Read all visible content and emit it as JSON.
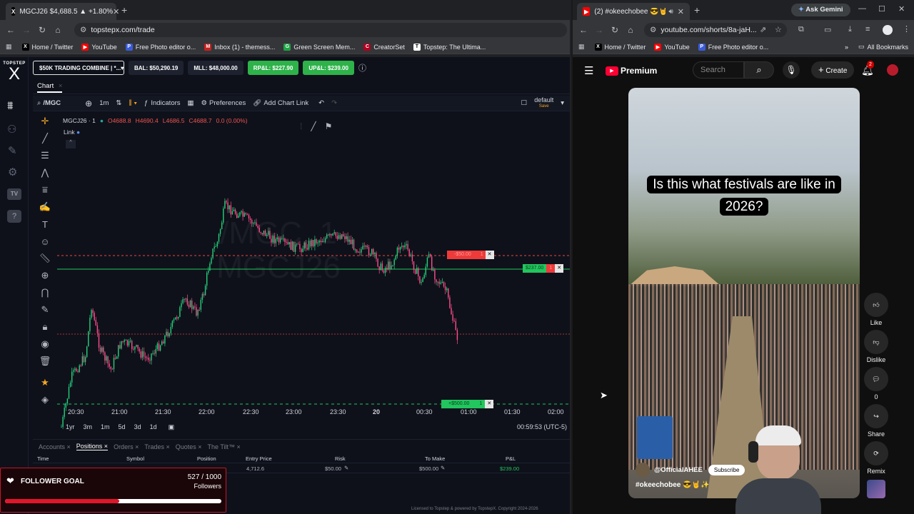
{
  "left_browser": {
    "tab": {
      "title": "MGCJ26 $4,688.5 ▲ +1.80%",
      "favicon": "X"
    },
    "new_tab": "+",
    "url": "topstepx.com/trade",
    "bookmarks": [
      "Home / Twitter",
      "YouTube",
      "Free Photo editor o...",
      "Inbox (1) - themess...",
      "Green Screen Mem...",
      "CreatorSet",
      "Topstep: The Ultima..."
    ]
  },
  "right_browser": {
    "tab": {
      "title": "(2) #okeechobee 😎🤘✨"
    },
    "ask_gemini": "Ask Gemini",
    "url": "youtube.com/shorts/8a-jaH...",
    "bookmarks": [
      "Home / Twitter",
      "YouTube",
      "Free Photo editor o..."
    ],
    "all_bookmarks": "All Bookmarks"
  },
  "topstep": {
    "logo_top": "TOPSTEP",
    "logo_x": "X",
    "account": "$50K TRADING COMBINE | *...",
    "balance": "BAL: $50,290.19",
    "mll": "MLL: $48,000.00",
    "rpl": "RP&L: $227.90",
    "upl": "UP&L: $239.00",
    "chart_tab": "Chart",
    "toolbar": {
      "symbol": "/MGC",
      "interval": "1m",
      "indicators": "Indicators",
      "preferences": "Preferences",
      "add_chart_link": "Add Chart Link",
      "layout": "default",
      "layout_sub": "Save"
    },
    "legend": {
      "symbol": "MGCJ26 · 1",
      "o": "O4688.8",
      "h": "H4690.4",
      "l": "L4686.5",
      "c": "C4688.7",
      "chg": "0.0 (0.00%)",
      "link": "Link"
    },
    "watermark_line1": "/MGC, 1",
    "watermark_line2": "MGCJ26",
    "order_labels": {
      "stop": "-$50.00",
      "stop_qty": "1",
      "pos": "$237.00",
      "pos_qty": "1",
      "target": "+$500.00",
      "target_qty": "1",
      "close": "✕"
    },
    "time_labels": [
      "20:30",
      "21:00",
      "21:30",
      "22:00",
      "22:30",
      "23:00",
      "23:30",
      "20",
      "00:30",
      "01:00",
      "01:30",
      "02:00"
    ],
    "ranges": [
      "1yr",
      "3m",
      "1m",
      "5d",
      "3d",
      "1d"
    ],
    "clock": "00:59:53 (UTC-5)",
    "bottom_tabs": [
      "Accounts",
      "Positions",
      "Orders",
      "Trades",
      "Quotes",
      "The Tilt™"
    ],
    "columns": [
      "Time",
      "Symbol",
      "Position",
      "Entry Price",
      "Risk",
      "To Make",
      "P&L"
    ],
    "row": {
      "entry": "4,712.6",
      "risk": "$50.00",
      "to_make": "$500.00",
      "pnl": "$239.00"
    },
    "license": "Licensed to Topstep & powered by TopstepX. Copyright 2024-2026"
  },
  "follower_goal": {
    "title": "FOLLOWER GOAL",
    "count": "527 / 1000",
    "unit": "Followers",
    "progress": 0.527
  },
  "youtube": {
    "brand": "Premium",
    "search_placeholder": "Search",
    "create": "Create",
    "notifications": "2",
    "caption": "Is this what festivals are like in 2026?",
    "channel": "@OfficialAHEE",
    "subscribe": "Subscribe",
    "hashtag": "#okeechobee 😎🤘✨",
    "actions": {
      "like": "Like",
      "dislike": "Dislike",
      "comments": "0",
      "share": "Share",
      "remix": "Remix"
    }
  },
  "colors": {
    "accent_green": "#22c55e",
    "accent_red": "#ef4444",
    "yt_red": "#ff0033",
    "candle_up": "#26d07c",
    "candle_down": "#ff4d8a"
  }
}
